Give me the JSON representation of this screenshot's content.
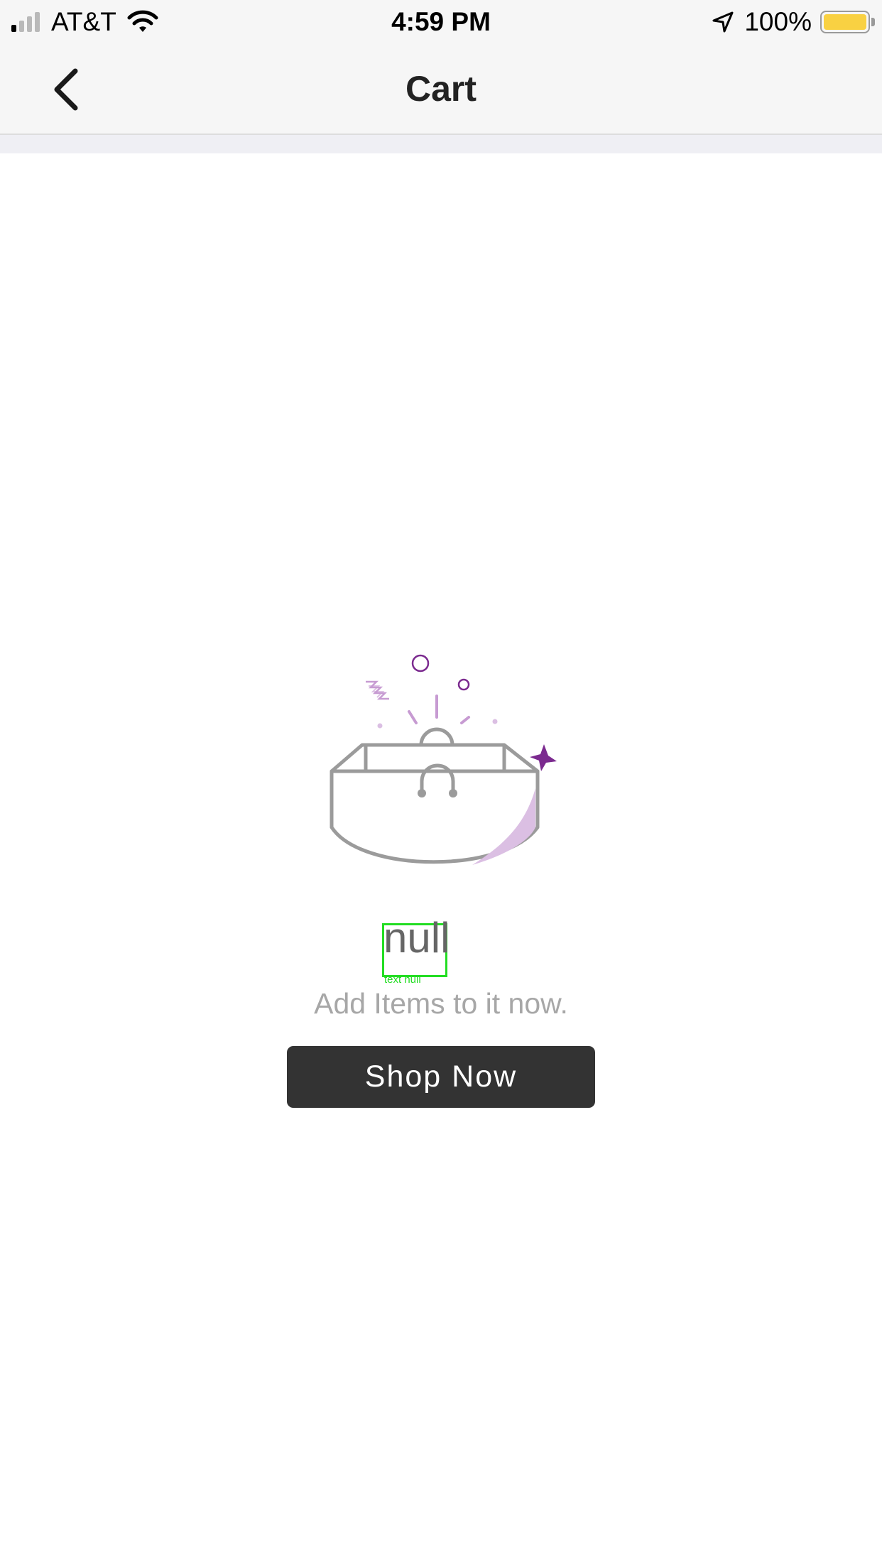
{
  "status_bar": {
    "carrier": "AT&T",
    "time": "4:59 PM",
    "battery_percent": "100%",
    "battery_level": 1.0,
    "signal_bars_active": 1,
    "signal_bars_total": 4,
    "icons": [
      "signal-icon",
      "wifi-icon",
      "location-arrow-icon",
      "battery-icon"
    ]
  },
  "nav": {
    "title": "Cart",
    "back_icon": "chevron-left-icon"
  },
  "empty_state": {
    "illustration_icon": "empty-shopping-bag-icon",
    "title": "null",
    "debug_label": "text null",
    "message": "Add Items to it now.",
    "button_label": "Shop Now"
  },
  "colors": {
    "accent_purple": "#7b2a8f",
    "light_purple": "#dbbfe3",
    "button_bg": "#333333",
    "debug_green": "#22dd22"
  }
}
